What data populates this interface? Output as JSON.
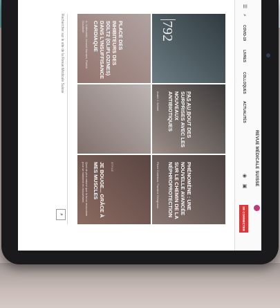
{
  "header": {
    "section_title": "REVUE MÉDICALE SUISSE",
    "nav": [
      "COVID-19",
      "LIVRES",
      "COLLOQUES",
      "ACTUALITÉS"
    ],
    "login_label": "SE CONNECTER",
    "icons": [
      "menu-icon",
      "search-icon",
      "user-icon",
      "cart-icon"
    ]
  },
  "cards": [
    {
      "category": "",
      "title": "",
      "description": "",
      "number": "792"
    },
    {
      "category": "ANTIBIOTIQUES",
      "title": "PAS AU BOUT DES SURPRISES AVEC LES NOUVEAUX ANTIBIOTIQUES",
      "description": "André J. Schmit"
    },
    {
      "category": "",
      "title": "PLACE DES INHIBITEURS DES SGLT2 (GLIFLOZINES) DANS L'INSUFFISANCE CARDIAQUE",
      "description": "A. Vuilleumier, Arnaud Barraira, Patrick Goudiaire"
    },
    {
      "category": "",
      "title": "PHÉNOMÈNE : UNE NOUVELLE AVANCÉE SUR LE CHEMIN DE LA NÉPHROPROTECTION",
      "description": "Pierre Corimbon, Faustine Grisignann"
    },
    {
      "category": "STYLE",
      "title": "JE BOUGE... GRÂCE À MES MUSCLES",
      "description": "Quoi de plus naturel que la force musculaire pour se maintenir en mouvement"
    },
    {
      "category": "",
      "title": "",
      "description": ""
    }
  ],
  "search": {
    "placeholder": "Rechercher sur le site de la Revue Médicale Suisse"
  },
  "colors": {
    "accent": "#d43a3a",
    "brand": "#c0397a"
  }
}
